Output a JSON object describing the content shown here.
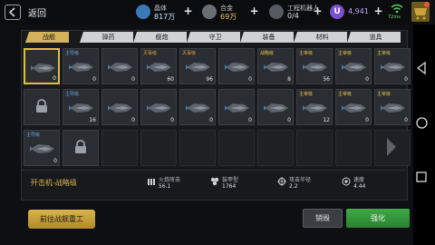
{
  "header": {
    "back_label": "返回",
    "resources": [
      {
        "label": "晶体",
        "value": "817万",
        "color": "#bfe6ff"
      },
      {
        "label": "合金",
        "value": "69万",
        "color": "#f0c060"
      },
      {
        "label": "工程机器人",
        "value": "0/4",
        "color": "#e0e0e0"
      }
    ],
    "gems": {
      "icon": "U",
      "value": "4,941"
    },
    "signal": "72ms"
  },
  "tabs": [
    {
      "label": "战舰",
      "active": true
    },
    {
      "label": "弹药",
      "active": false
    },
    {
      "label": "舰炮",
      "active": false
    },
    {
      "label": "守卫",
      "active": false
    },
    {
      "label": "装备",
      "active": false
    },
    {
      "label": "材料",
      "active": false
    },
    {
      "label": "道具",
      "active": false
    }
  ],
  "items_row1": [
    {
      "tag": "",
      "count": "0",
      "selected": true
    },
    {
      "tag": "主导级",
      "count": "0"
    },
    {
      "tag": "",
      "count": "0"
    },
    {
      "tag": "灭毒级",
      "count": "60"
    },
    {
      "tag": "灭毒级",
      "count": "96"
    },
    {
      "tag": "",
      "count": "0"
    },
    {
      "tag": "战略级",
      "count": "8"
    },
    {
      "tag": "主宰级",
      "count": "56"
    },
    {
      "tag": "主宰级",
      "count": "0"
    },
    {
      "tag": "主宰级",
      "count": "0"
    }
  ],
  "items_row2": [
    {
      "tag": "",
      "count": "",
      "locked": true
    },
    {
      "tag": "主导级",
      "count": "16"
    },
    {
      "tag": "",
      "count": "0"
    },
    {
      "tag": "",
      "count": "0"
    },
    {
      "tag": "",
      "count": "0"
    },
    {
      "tag": "",
      "count": "0"
    },
    {
      "tag": "",
      "count": "0"
    },
    {
      "tag": "主宰级",
      "count": "12"
    },
    {
      "tag": "主宰级",
      "count": "0"
    },
    {
      "tag": "主宰级",
      "count": "0"
    }
  ],
  "items_row3": [
    {
      "tag": "主导级",
      "count": "0"
    },
    {
      "tag": "",
      "count": "",
      "locked": true
    }
  ],
  "detail": {
    "ship_name": "歼击机-战略级",
    "stats": [
      {
        "label": "火炮攻击",
        "value": "56.1"
      },
      {
        "label": "装甲型",
        "value": "1764"
      },
      {
        "label": "攻击半径",
        "value": "2.2"
      },
      {
        "label": "速度",
        "value": "4.44"
      }
    ]
  },
  "actions": {
    "goto_label": "前往战舰重工",
    "scrap_label": "销毁",
    "upgrade_label": "强化"
  }
}
